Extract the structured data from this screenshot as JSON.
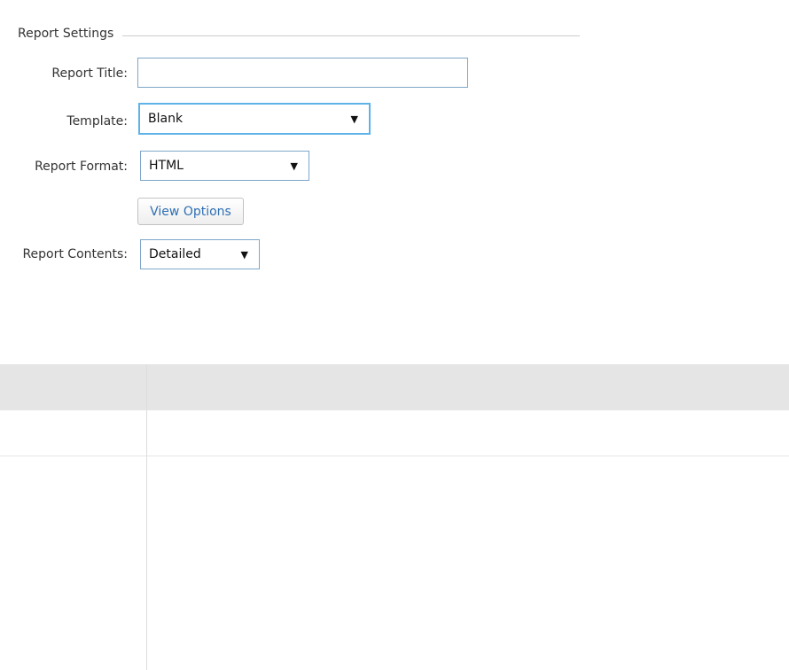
{
  "report_settings": {
    "legend": "Report Settings",
    "title_label": "Report Title:",
    "title_value": "",
    "template_label": "Template:",
    "template_value": "Blank",
    "format_label": "Report Format:",
    "format_value": "HTML",
    "view_options_label": "View Options",
    "contents_label": "Report Contents:",
    "contents_value": "Detailed"
  },
  "icons": {
    "dropdown": "caret-down-icon"
  },
  "colors": {
    "input_border": "#7ea6c9",
    "focus_border": "#5db2e8",
    "button_text": "#2f6fb3",
    "grid_header": "#e5e5e5"
  },
  "grid": {
    "columns": [
      "",
      ""
    ],
    "rows": [
      [
        "",
        ""
      ],
      [
        "",
        ""
      ]
    ]
  }
}
